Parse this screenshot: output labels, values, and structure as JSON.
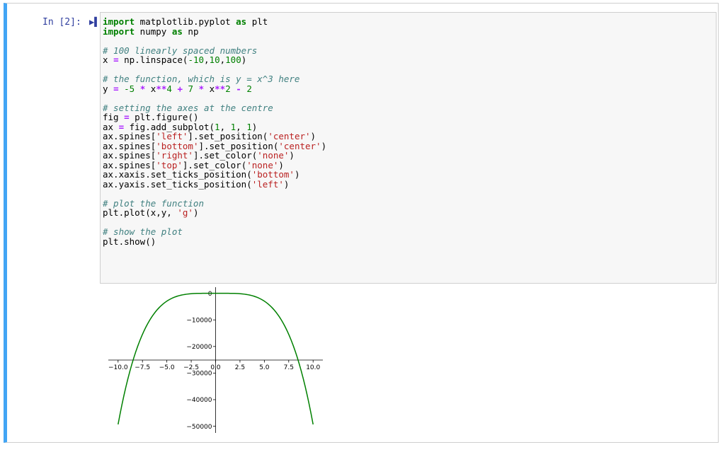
{
  "cell": {
    "prompt": "In [2]:",
    "run_icon": "run-cell-icon",
    "accent_color": "#42a5f5"
  },
  "code": {
    "lines": [
      [
        {
          "t": "import",
          "c": "kw"
        },
        {
          "t": " matplotlib.pyplot ",
          "c": ""
        },
        {
          "t": "as",
          "c": "kw"
        },
        {
          "t": " plt",
          "c": ""
        }
      ],
      [
        {
          "t": "import",
          "c": "kw"
        },
        {
          "t": " numpy ",
          "c": ""
        },
        {
          "t": "as",
          "c": "kw"
        },
        {
          "t": " np",
          "c": ""
        }
      ],
      [],
      [
        {
          "t": "# 100 linearly spaced numbers",
          "c": "cm"
        }
      ],
      [
        {
          "t": "x ",
          "c": ""
        },
        {
          "t": "=",
          "c": "op"
        },
        {
          "t": " np.linspace(",
          "c": ""
        },
        {
          "t": "-10",
          "c": "num"
        },
        {
          "t": ",",
          "c": ""
        },
        {
          "t": "10",
          "c": "num"
        },
        {
          "t": ",",
          "c": ""
        },
        {
          "t": "100",
          "c": "num"
        },
        {
          "t": ")",
          "c": ""
        }
      ],
      [],
      [
        {
          "t": "# the function, which is y = x^3 here",
          "c": "cm"
        }
      ],
      [
        {
          "t": "y ",
          "c": ""
        },
        {
          "t": "=",
          "c": "op"
        },
        {
          "t": " ",
          "c": ""
        },
        {
          "t": "-5",
          "c": "num"
        },
        {
          "t": " ",
          "c": ""
        },
        {
          "t": "*",
          "c": "op"
        },
        {
          "t": " x",
          "c": ""
        },
        {
          "t": "**",
          "c": "op"
        },
        {
          "t": "4",
          "c": "num"
        },
        {
          "t": " ",
          "c": ""
        },
        {
          "t": "+",
          "c": "op"
        },
        {
          "t": " ",
          "c": ""
        },
        {
          "t": "7",
          "c": "num"
        },
        {
          "t": " ",
          "c": ""
        },
        {
          "t": "*",
          "c": "op"
        },
        {
          "t": " x",
          "c": ""
        },
        {
          "t": "**",
          "c": "op"
        },
        {
          "t": "2",
          "c": "num"
        },
        {
          "t": " ",
          "c": ""
        },
        {
          "t": "-",
          "c": "op"
        },
        {
          "t": " ",
          "c": ""
        },
        {
          "t": "2",
          "c": "num"
        }
      ],
      [],
      [
        {
          "t": "# setting the axes at the centre",
          "c": "cm"
        }
      ],
      [
        {
          "t": "fig ",
          "c": ""
        },
        {
          "t": "=",
          "c": "op"
        },
        {
          "t": " plt.figure()",
          "c": ""
        }
      ],
      [
        {
          "t": "ax ",
          "c": ""
        },
        {
          "t": "=",
          "c": "op"
        },
        {
          "t": " fig.add_subplot(",
          "c": ""
        },
        {
          "t": "1",
          "c": "num"
        },
        {
          "t": ", ",
          "c": ""
        },
        {
          "t": "1",
          "c": "num"
        },
        {
          "t": ", ",
          "c": ""
        },
        {
          "t": "1",
          "c": "num"
        },
        {
          "t": ")",
          "c": ""
        }
      ],
      [
        {
          "t": "ax.spines[",
          "c": ""
        },
        {
          "t": "'left'",
          "c": "str"
        },
        {
          "t": "].set_position(",
          "c": ""
        },
        {
          "t": "'center'",
          "c": "str"
        },
        {
          "t": ")",
          "c": ""
        }
      ],
      [
        {
          "t": "ax.spines[",
          "c": ""
        },
        {
          "t": "'bottom'",
          "c": "str"
        },
        {
          "t": "].set_position(",
          "c": ""
        },
        {
          "t": "'center'",
          "c": "str"
        },
        {
          "t": ")",
          "c": ""
        }
      ],
      [
        {
          "t": "ax.spines[",
          "c": ""
        },
        {
          "t": "'right'",
          "c": "str"
        },
        {
          "t": "].set_color(",
          "c": ""
        },
        {
          "t": "'none'",
          "c": "str"
        },
        {
          "t": ")",
          "c": ""
        }
      ],
      [
        {
          "t": "ax.spines[",
          "c": ""
        },
        {
          "t": "'top'",
          "c": "str"
        },
        {
          "t": "].set_color(",
          "c": ""
        },
        {
          "t": "'none'",
          "c": "str"
        },
        {
          "t": ")",
          "c": ""
        }
      ],
      [
        {
          "t": "ax.xaxis.set_ticks_position(",
          "c": ""
        },
        {
          "t": "'bottom'",
          "c": "str"
        },
        {
          "t": ")",
          "c": ""
        }
      ],
      [
        {
          "t": "ax.yaxis.set_ticks_position(",
          "c": ""
        },
        {
          "t": "'left'",
          "c": "str"
        },
        {
          "t": ")",
          "c": ""
        }
      ],
      [],
      [
        {
          "t": "# plot the function",
          "c": "cm"
        }
      ],
      [
        {
          "t": "plt.plot(x,y, ",
          "c": ""
        },
        {
          "t": "'g'",
          "c": "str"
        },
        {
          "t": ")",
          "c": ""
        }
      ],
      [],
      [
        {
          "t": "# show the plot",
          "c": "cm"
        }
      ],
      [
        {
          "t": "plt.show()",
          "c": ""
        }
      ]
    ]
  },
  "chart_data": {
    "type": "line",
    "series": [
      {
        "color": "green",
        "function": "y = -5 * x**4 + 7 * x**2 - 2",
        "x_range": [
          -10,
          10
        ],
        "points": 100
      }
    ],
    "x_ticks": [
      -10.0,
      -7.5,
      -5.0,
      -2.5,
      0.0,
      2.5,
      5.0,
      7.5,
      10.0
    ],
    "x_tick_labels": [
      "−10.0",
      "−7.5",
      "−5.0",
      "−2.5",
      "0.0",
      "2.5",
      "5.0",
      "7.5",
      "10.0"
    ],
    "y_ticks": [
      0,
      -10000,
      -20000,
      -30000,
      -40000,
      -50000
    ],
    "y_tick_labels": [
      "0",
      "−10000",
      "−20000",
      "−30000",
      "−40000",
      "−50000"
    ],
    "xlim": [
      -11,
      11
    ],
    "ylim": [
      -52500,
      2300
    ],
    "spines": "center",
    "line_color": "#008000",
    "grid": false
  }
}
